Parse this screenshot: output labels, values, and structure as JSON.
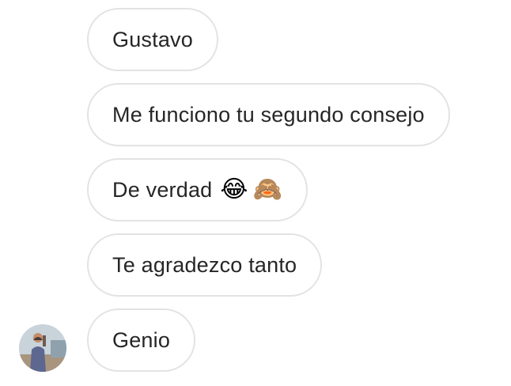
{
  "messages": [
    {
      "text": "Gustavo"
    },
    {
      "text": "Me funciono tu segundo consejo"
    },
    {
      "text": "De verdad",
      "emojis": [
        "😂",
        "🙈"
      ]
    },
    {
      "text": "Te agradezco tanto"
    },
    {
      "text": "Genio"
    }
  ],
  "avatar": {
    "icon": "user-photo-avatar"
  },
  "colors": {
    "bubble_border": "#e3e3e3",
    "text": "#262626",
    "background": "#ffffff"
  }
}
